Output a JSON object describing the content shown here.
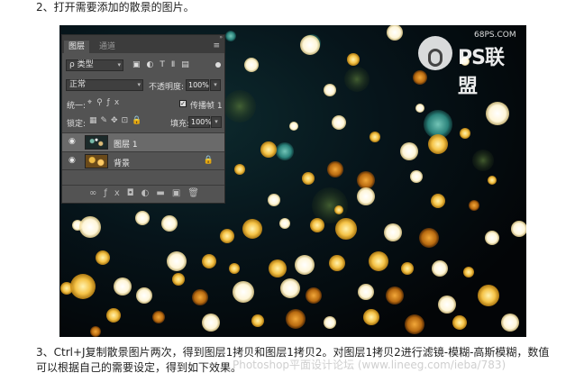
{
  "article": {
    "step2": "2、打开需要添加的散景的图片。",
    "step3": "3、Ctrl+J复制散景图片两次，得到图层1拷贝和图层1拷贝2。对图层1拷贝2进行滤镜-模糊-高斯模糊，数值可以根据自己的需要设定，得到如下效果。"
  },
  "watermark": {
    "brand": "PS联盟",
    "site": "68PS.COM"
  },
  "ghost_watermark": "Photoshop平面设计论坛 (www.lineeg.com/ieba/783)",
  "panel": {
    "tabs": [
      {
        "label": "图层",
        "active": true
      },
      {
        "label": "通道",
        "active": false
      }
    ],
    "filter_kind": "ρ 类型",
    "blend_mode": "正常",
    "opacity_label": "不透明度:",
    "opacity_value": "100%",
    "unify_label": "统一:",
    "propagate_label": "传播帧 1",
    "lock_label": "锁定:",
    "fill_label": "填充:",
    "fill_value": "100%",
    "layers": [
      {
        "name": "图层 1",
        "selected": true,
        "locked": false
      },
      {
        "name": "背景",
        "selected": false,
        "locked": true
      }
    ]
  },
  "colors": {
    "panel_bg": "#535353",
    "panel_dark": "#3c3c3c",
    "selected_layer": "#6a6a6a"
  }
}
